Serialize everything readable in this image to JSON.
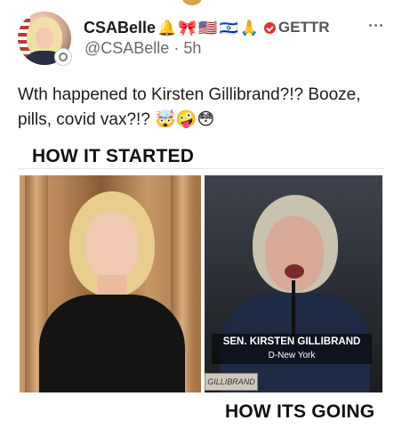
{
  "post": {
    "author": {
      "display_name": "CSABelle",
      "name_emojis": [
        "🔔",
        "🎀",
        "🇺🇸",
        "🇮🇱",
        "🙏"
      ],
      "badge_text": "GETTR",
      "handle": "@CSABelle",
      "separator": "·",
      "time_ago": "5h"
    },
    "menu_icon": "more-horizontal-icon",
    "text": "Wth happened to Kirsten Gillibrand?!? Booze, pills, covid vax?!? 🤯🤪😳",
    "media": {
      "caption_top": "HOW IT STARTED",
      "caption_bottom": "HOW ITS GOING",
      "lower_third_name": "SEN. KIRSTEN GILLIBRAND",
      "lower_third_party": "D-New York",
      "nameplate_text": "GILLIBRAND"
    }
  },
  "colors": {
    "badge_red": "#e0322f",
    "handle_gray": "#6b6b6b",
    "text_dark": "#1c1c1c"
  }
}
